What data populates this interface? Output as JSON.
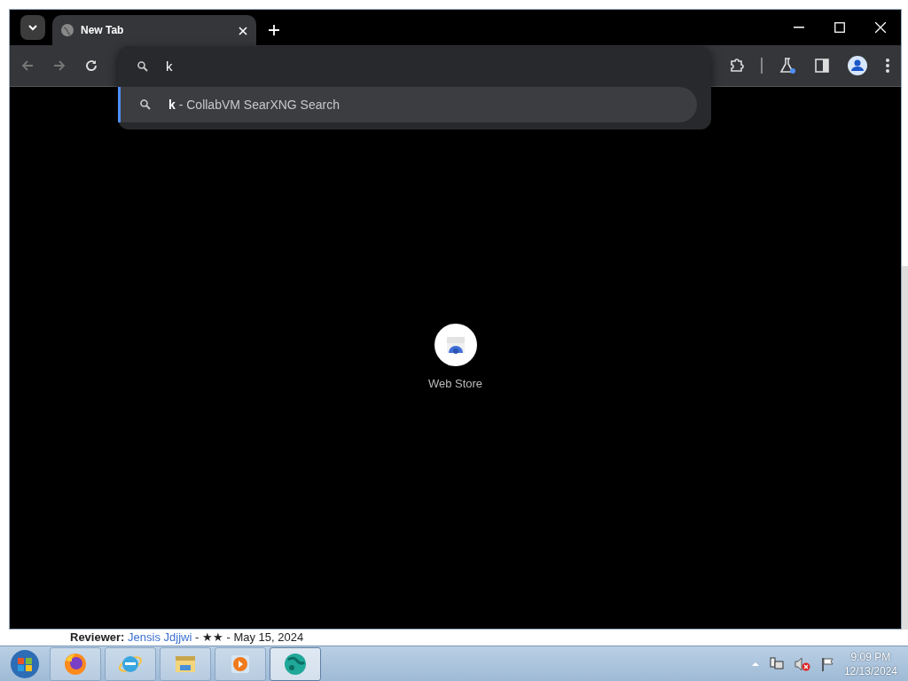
{
  "browser": {
    "tabs": [
      {
        "title": "New Tab",
        "selected": true
      }
    ],
    "address_bar": {
      "value": "k"
    },
    "suggestions": [
      {
        "text": "**k** - CollabVM SearXNG Search",
        "selected": true
      }
    ],
    "shortcuts": [
      {
        "label": "Web Store"
      }
    ]
  },
  "background_page": {
    "label": "Reviewer:",
    "reviewer": "Jensis Jdjjwi",
    "rest": " - ★★ - May 15, 2024"
  },
  "taskbar": {
    "apps": [
      {
        "kind": "firefox",
        "selected": false
      },
      {
        "kind": "ie",
        "selected": false
      },
      {
        "kind": "explorer",
        "selected": false
      },
      {
        "kind": "media",
        "selected": false
      },
      {
        "kind": "globe",
        "selected": true
      }
    ],
    "clock": {
      "time": "9:09 PM",
      "date": "12/13/2024"
    }
  }
}
